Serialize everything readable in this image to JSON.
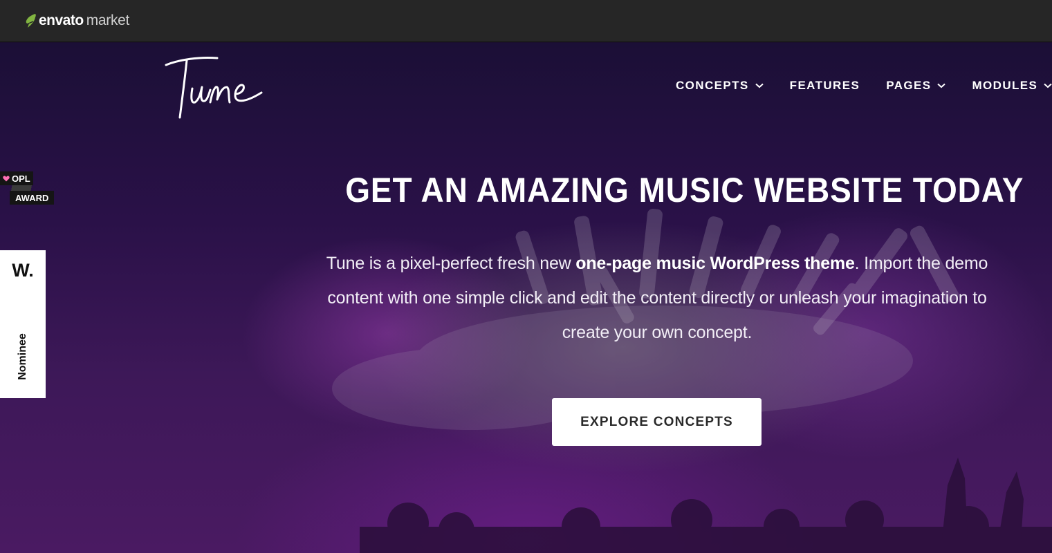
{
  "envato_bar": {
    "brand": "envato",
    "market": "market",
    "accent_color": "#82b541"
  },
  "site": {
    "logo_text": "Tune"
  },
  "nav": {
    "items": [
      {
        "label": "CONCEPTS",
        "has_dropdown": true
      },
      {
        "label": "FEATURES",
        "has_dropdown": false
      },
      {
        "label": "PAGES",
        "has_dropdown": true
      },
      {
        "label": "MODULES",
        "has_dropdown": true
      }
    ]
  },
  "badges": {
    "opl_line1": "OPL",
    "opl_line2": "AWARD",
    "opl_heart_color": "#ff6fb5",
    "w_mark": "W.",
    "w_label": "Nominee"
  },
  "hero": {
    "title": "GET AN AMAZING MUSIC WEBSITE TODAY",
    "description_prefix": "Tune is a pixel-perfect fresh new ",
    "description_bold": "one-page music WordPress theme",
    "description_suffix": ". Import the demo content with one simple click and edit the content directly or unleash your imagination to create your own concept.",
    "cta_label": "EXPLORE CONCEPTS"
  }
}
